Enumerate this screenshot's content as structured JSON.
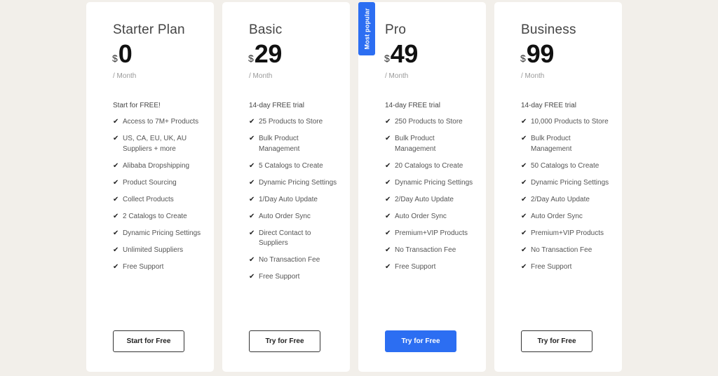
{
  "accent_color": "#2c6ef2",
  "background_color": "#f2efea",
  "check_icon": "checkmark-icon",
  "plans": [
    {
      "name": "Starter Plan",
      "currency": "$",
      "price": "0",
      "period": "/ Month",
      "intro": "Start for FREE!",
      "badge": null,
      "features": [
        "Access to 7M+ Products",
        "US, CA, EU, UK, AU Suppliers + more",
        "Alibaba Dropshipping",
        "Product Sourcing",
        "Collect Products",
        "2 Catalogs to Create",
        "Dynamic Pricing Settings",
        "Unlimited Suppliers",
        "Free Support"
      ],
      "button_label": "Start for Free",
      "button_style": "outline"
    },
    {
      "name": "Basic",
      "currency": "$",
      "price": "29",
      "period": "/ Month",
      "intro": "14-day FREE trial",
      "badge": null,
      "features": [
        "25 Products to Store",
        "Bulk Product Management",
        "5 Catalogs to Create",
        "Dynamic Pricing Settings",
        "1/Day Auto Update",
        "Auto Order Sync",
        "Direct Contact to Suppliers",
        "No Transaction Fee",
        "Free Support"
      ],
      "button_label": "Try for Free",
      "button_style": "outline"
    },
    {
      "name": "Pro",
      "currency": "$",
      "price": "49",
      "period": "/ Month",
      "intro": "14-day FREE trial",
      "badge": "Most popular",
      "features": [
        "250 Products to Store",
        "Bulk Product Management",
        "20 Catalogs to Create",
        "Dynamic Pricing Settings",
        "2/Day Auto Update",
        "Auto Order Sync",
        "Premium+VIP Products",
        "No Transaction Fee",
        "Free Support"
      ],
      "button_label": "Try for Free",
      "button_style": "primary"
    },
    {
      "name": "Business",
      "currency": "$",
      "price": "99",
      "period": "/ Month",
      "intro": "14-day FREE trial",
      "badge": null,
      "features": [
        "10,000 Products to Store",
        "Bulk Product Management",
        "50 Catalogs to Create",
        "Dynamic Pricing Settings",
        "2/Day Auto Update",
        "Auto Order Sync",
        "Premium+VIP Products",
        "No Transaction Fee",
        "Free Support"
      ],
      "button_label": "Try for Free",
      "button_style": "outline"
    }
  ]
}
